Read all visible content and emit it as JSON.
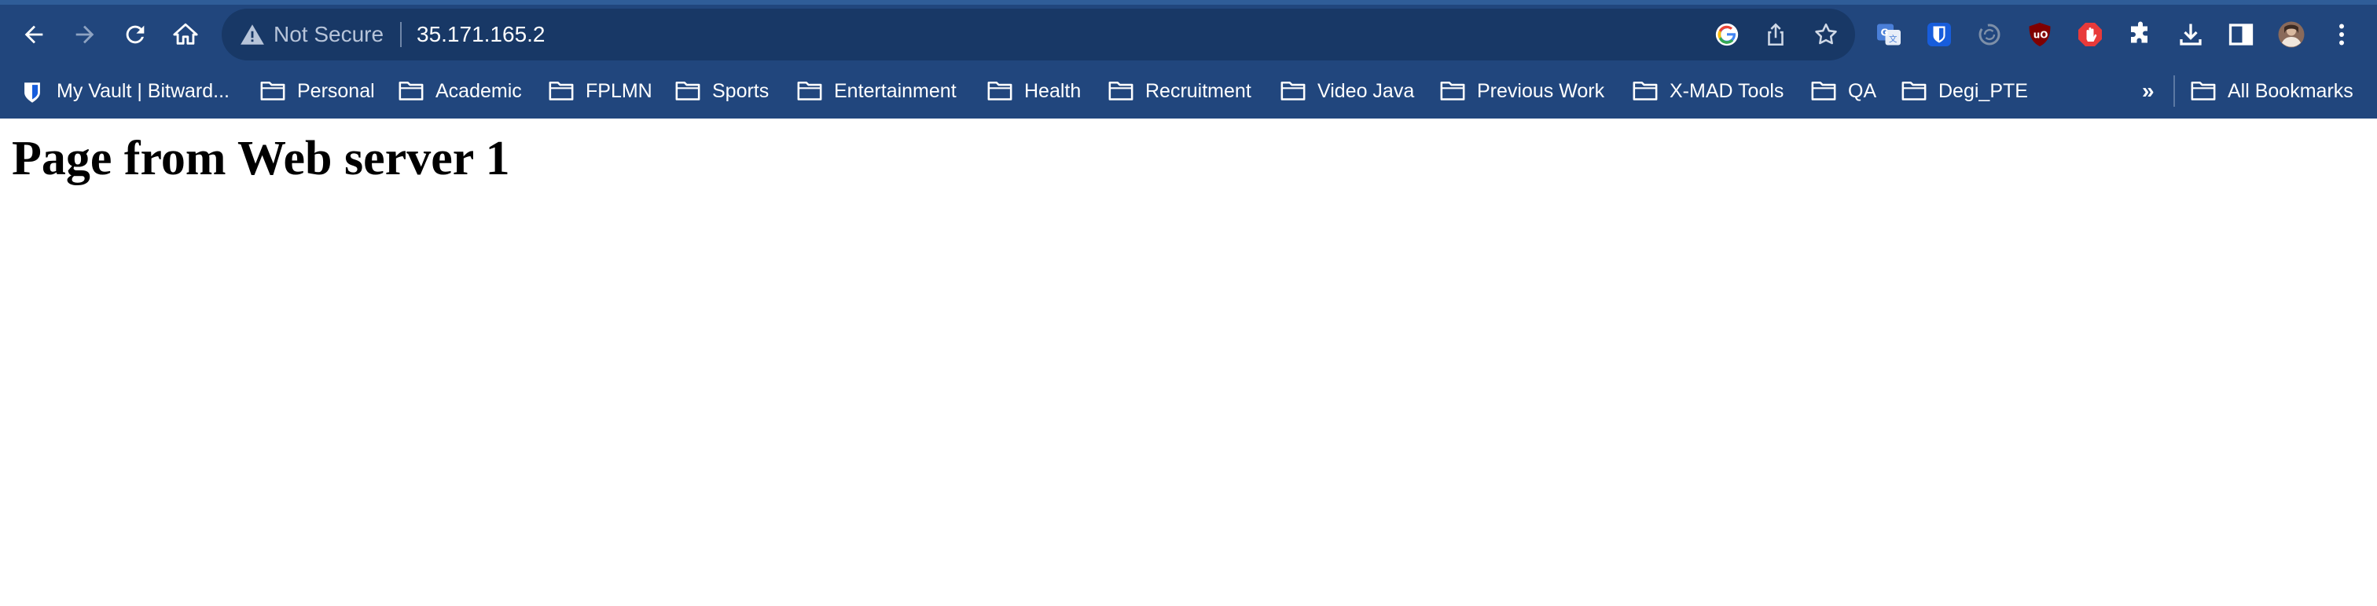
{
  "browser": {
    "colors": {
      "frame": "#21467d",
      "omnibox": "#183866",
      "text": "#ffffff",
      "muted": "#b7c4d9"
    },
    "nav": [
      {
        "name": "back-icon"
      },
      {
        "name": "forward-icon"
      },
      {
        "name": "reload-icon"
      },
      {
        "name": "home-icon"
      }
    ],
    "omnibox": {
      "security_label": "Not Secure",
      "url": "35.171.165.2"
    },
    "omnibox_icons": [
      "google-lens-icon",
      "share-icon",
      "bookmark-star-icon"
    ],
    "extensions": [
      "google-translate-icon",
      "bitwarden-icon",
      "sync-icon",
      "ublock-origin-icon",
      "adblock-icon",
      "extensions-puzzle-icon",
      "download-icon",
      "side-panel-icon",
      "profile-avatar",
      "more-menu-icon"
    ],
    "bookmarks": [
      {
        "label": "My Vault | Bitward...",
        "icon": "bitwarden-icon"
      },
      {
        "label": "Personal",
        "icon": "folder-icon"
      },
      {
        "label": "Academic",
        "icon": "folder-icon"
      },
      {
        "label": "FPLMN",
        "icon": "folder-icon"
      },
      {
        "label": "Sports",
        "icon": "folder-icon"
      },
      {
        "label": "Entertainment",
        "icon": "folder-icon"
      },
      {
        "label": "Health",
        "icon": "folder-icon"
      },
      {
        "label": "Recruitment",
        "icon": "folder-icon"
      },
      {
        "label": "Video Java",
        "icon": "folder-icon"
      },
      {
        "label": "Previous Work",
        "icon": "folder-icon"
      },
      {
        "label": "X-MAD Tools",
        "icon": "folder-icon"
      },
      {
        "label": "QA",
        "icon": "folder-icon"
      },
      {
        "label": "Degi_PTE",
        "icon": "folder-icon"
      }
    ],
    "overflow_label": "»",
    "all_bookmarks": {
      "label": "All Bookmarks",
      "icon": "folder-icon"
    }
  },
  "page": {
    "heading": "Page from Web server 1"
  }
}
